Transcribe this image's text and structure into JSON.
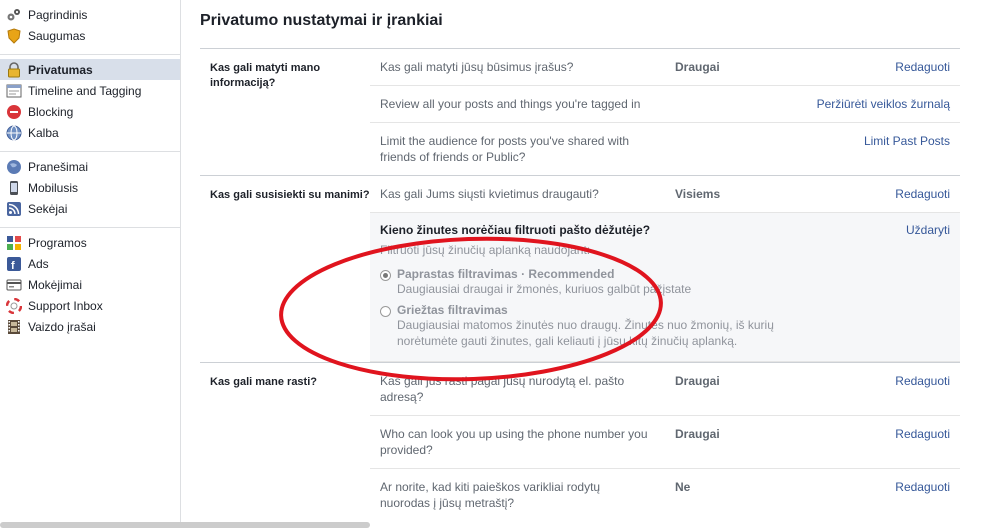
{
  "sidebar": {
    "groups": [
      [
        {
          "label": "Pagrindinis",
          "icon": "gears-icon"
        },
        {
          "label": "Saugumas",
          "icon": "shield-icon"
        }
      ],
      [
        {
          "label": "Privatumas",
          "icon": "lock-icon",
          "active": true
        },
        {
          "label": "Timeline and Tagging",
          "icon": "timeline-icon"
        },
        {
          "label": "Blocking",
          "icon": "blocking-icon"
        },
        {
          "label": "Kalba",
          "icon": "globe-icon"
        }
      ],
      [
        {
          "label": "Pranešimai",
          "icon": "globe-notifications-icon"
        },
        {
          "label": "Mobilusis",
          "icon": "mobile-icon"
        },
        {
          "label": "Sekėjai",
          "icon": "rss-icon"
        }
      ],
      [
        {
          "label": "Programos",
          "icon": "apps-icon"
        },
        {
          "label": "Ads",
          "icon": "ads-icon"
        },
        {
          "label": "Mokėjimai",
          "icon": "payments-icon"
        },
        {
          "label": "Support Inbox",
          "icon": "lifebuoy-icon"
        },
        {
          "label": "Vaizdo įrašai",
          "icon": "film-icon"
        }
      ]
    ]
  },
  "main": {
    "title": "Privatumo nustatymai ir įrankiai",
    "sections": {
      "s1": {
        "label": "Kas gali matyti mano informaciją?",
        "rows": [
          {
            "q": "Kas gali matyti jūsų būsimus įrašus?",
            "v": "Draugai",
            "a": "Redaguoti"
          },
          {
            "q": "Review all your posts and things you're tagged in",
            "v": "",
            "a": "Peržiūrėti veiklos žurnalą"
          },
          {
            "q": "Limit the audience for posts you've shared with friends of friends or Public?",
            "v": "",
            "a": "Limit Past Posts"
          }
        ]
      },
      "s2": {
        "label": "Kas gali susisiekti su manimi?",
        "row": {
          "q": "Kas gali Jums siųsti kvietimus draugauti?",
          "v": "Visiems",
          "a": "Redaguoti"
        },
        "expanded": {
          "title": "Kieno žinutes norėčiau filtruoti pašto dėžutėje?",
          "close": "Uždaryti",
          "intro": "Filtruoti jūsų žinučių aplanką naudojant:",
          "option1_title": "Paprastas filtravimas · Recommended",
          "option1_desc": "Daugiausiai draugai ir žmonės, kuriuos galbūt pažįstate",
          "option2_title": "Griežtas filtravimas",
          "option2_desc": "Daugiausiai matomos žinutės nuo draugų. Žinutės nuo žmonių, iš kurių norėtumėte gauti žinutes, gali keliauti į jūsų kitų žinučių aplanką."
        }
      },
      "s3": {
        "label": "Kas gali mane rasti?",
        "rows": [
          {
            "q": "Kas gali jus rasti pagal jūsų nurodytą el. pašto adresą?",
            "v": "Draugai",
            "a": "Redaguoti"
          },
          {
            "q": "Who can look you up using the phone number you provided?",
            "v": "Draugai",
            "a": "Redaguoti"
          },
          {
            "q": "Ar norite, kad kiti paieškos varikliai rodytų nuorodas į jūsų metraštį?",
            "v": "Ne",
            "a": "Redaguoti"
          }
        ]
      }
    }
  },
  "colors": {
    "link": "#365899",
    "active_bg": "#d8dfea",
    "annotation": "#e0141e"
  }
}
